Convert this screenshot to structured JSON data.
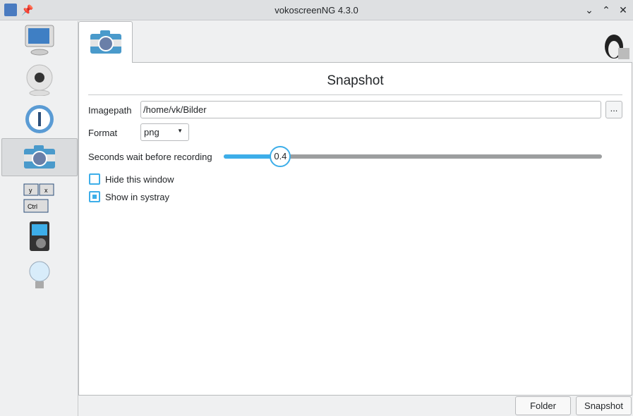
{
  "window": {
    "title": "vokoscreenNG 4.3.0",
    "app_icon": "vokoscreen-icon",
    "pin_icon": "pin-icon",
    "controls": [
      "minimize",
      "maximize",
      "close"
    ]
  },
  "sidebar": {
    "items": [
      {
        "name": "screencast",
        "icon": "monitor-icon"
      },
      {
        "name": "camera",
        "icon": "webcam-icon"
      },
      {
        "name": "player",
        "icon": "player-icon"
      },
      {
        "name": "snapshot",
        "icon": "camera-icon",
        "active": true
      },
      {
        "name": "keyboard",
        "icon": "keyboard-icon",
        "keys": [
          "y",
          "x",
          "Ctrl"
        ]
      },
      {
        "name": "media",
        "icon": "media-player-icon"
      },
      {
        "name": "info",
        "icon": "lightbulb-icon"
      }
    ]
  },
  "main": {
    "tab_icon": "camera-icon",
    "os_icon": "linux-tux-icon",
    "heading": "Snapshot",
    "imagepath_label": "Imagepath",
    "imagepath_value": "/home/vk/Bilder",
    "browse_label": "...",
    "format_label": "Format",
    "format_value": "png",
    "wait_label": "Seconds wait before recording",
    "wait_value": "0.4",
    "wait_fraction": 0.15,
    "hide_window_label": "Hide this window",
    "hide_window_checked": false,
    "systray_label": "Show in systray",
    "systray_checked": true
  },
  "buttons": {
    "folder": "Folder",
    "snapshot": "Snapshot"
  },
  "colors": {
    "accent": "#3daee9"
  }
}
